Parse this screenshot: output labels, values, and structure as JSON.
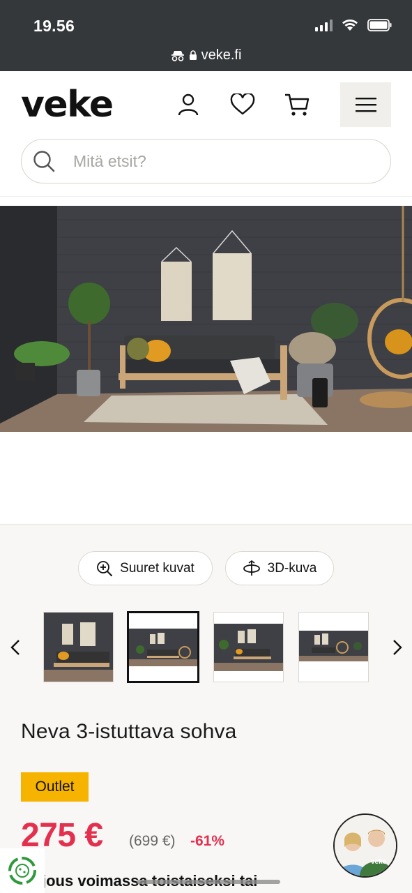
{
  "status_bar": {
    "time": "19.56"
  },
  "browser": {
    "url": "veke.fi"
  },
  "header": {
    "logo": "veke",
    "search_placeholder": "Mitä etsit?",
    "icons": [
      "user-icon",
      "heart-icon",
      "cart-icon",
      "menu-icon"
    ]
  },
  "gallery": {
    "large_images_label": "Suuret kuvat",
    "view_3d_label": "3D-kuva",
    "selected_thumbnail": 2,
    "thumbnail_count": 4
  },
  "product": {
    "name": "Neva 3-istuttava sohva",
    "badge": "Outlet",
    "price": "275 €",
    "old_price": "(699 €)",
    "discount": "-61%",
    "offer_text": "jous voimassa toistaiseksi tai"
  },
  "colors": {
    "price_red": "#e4304f",
    "badge_yellow": "#f6b300",
    "status_bar": "#35383b"
  }
}
